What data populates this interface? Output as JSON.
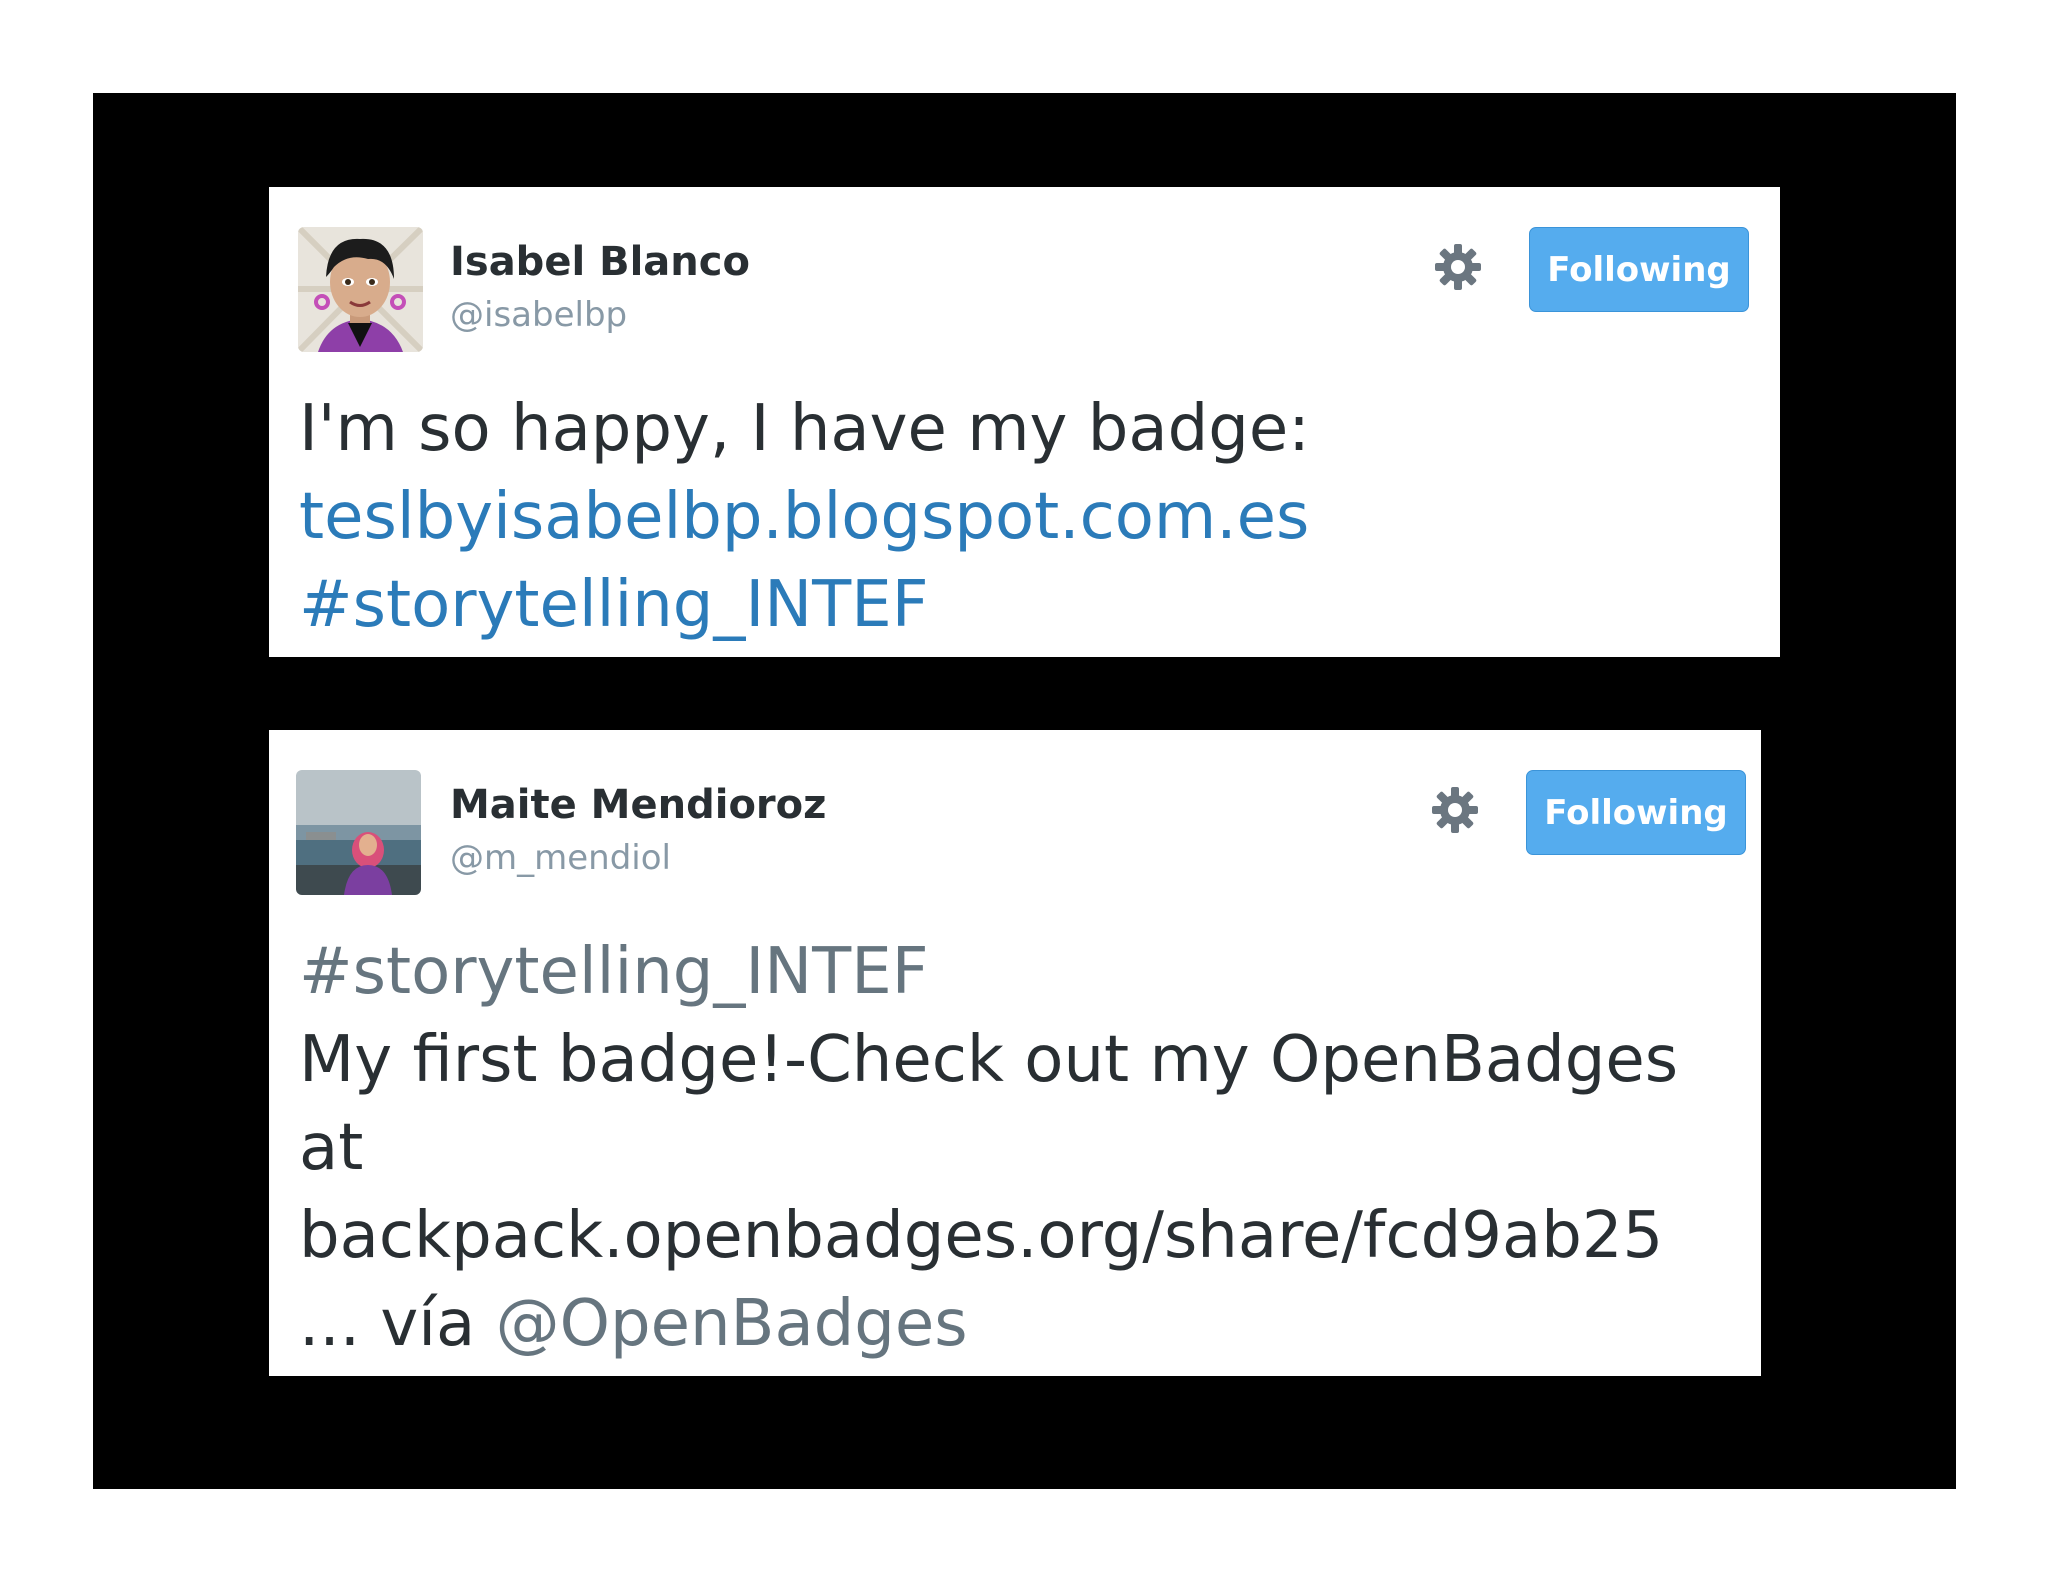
{
  "tweets": [
    {
      "author": {
        "name": "Isabel Blanco",
        "handle": "@isabelbp"
      },
      "follow_label": "Following",
      "lines": {
        "line1": "I'm so happy, I have my badge:",
        "line2_link": "teslbyisabelbp.blogspot.com.es",
        "line3_hashtag": "#storytelling_INTEF"
      }
    },
    {
      "author": {
        "name": "Maite Mendioroz",
        "handle": "@m_mendiol"
      },
      "follow_label": "Following",
      "lines": {
        "line1_hashtag": "#storytelling_INTEF",
        "line2": "My first badge!-Check out my OpenBadges",
        "line3": "at",
        "line4": "backpack.openbadges.org/share/fcd9ab25",
        "line5_prefix": "... vía ",
        "line5_mention": "@OpenBadges"
      }
    }
  ],
  "icons": {
    "settings": "gear-icon"
  },
  "colors": {
    "follow_button": "#55acee",
    "link": "#2b7bb9",
    "handle": "#8899a6",
    "text": "#292f33",
    "frame": "#000000"
  }
}
